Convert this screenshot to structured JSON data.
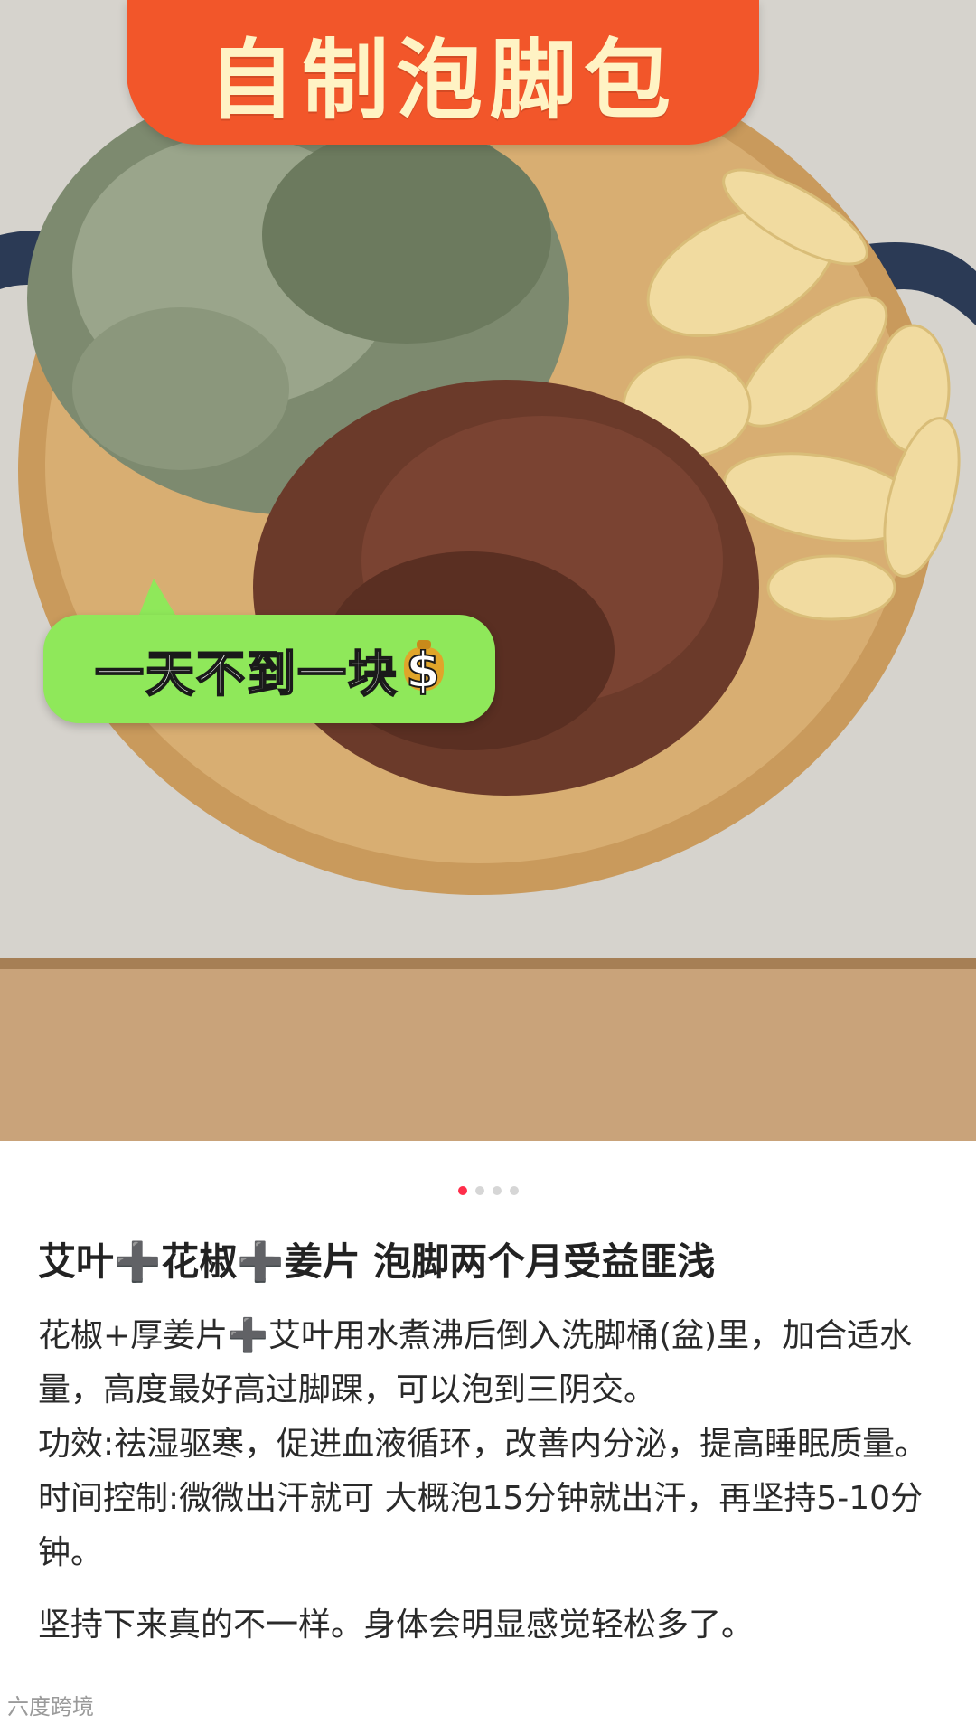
{
  "image": {
    "title": "自制泡脚包",
    "bubble_text": "一天不到一块",
    "bubble_icon": "money-bag-icon"
  },
  "carousel": {
    "count": 4,
    "active_index": 0
  },
  "post": {
    "headline": "艾叶➕花椒➕姜片 泡脚两个月受益匪浅",
    "paragraphs": [
      "花椒+厚姜片➕艾叶用水煮沸后倒入洗脚桶(盆)里，加合适水量，高度最好高过脚踝，可以泡到三阴交。",
      "功效:祛湿驱寒，促进血液循环，改善内分泌，提高睡眠质量。",
      "时间控制:微微出汗就可 大概泡15分钟就出汗，再坚持5-10分钟。",
      "坚持下来真的不一样。身体会明显感觉轻松多了。"
    ]
  },
  "watermark": "六度跨境",
  "colors": {
    "title_bg": "#f2562a",
    "bubble_bg": "#8fe85a",
    "active_dot": "#ff2d4a"
  }
}
